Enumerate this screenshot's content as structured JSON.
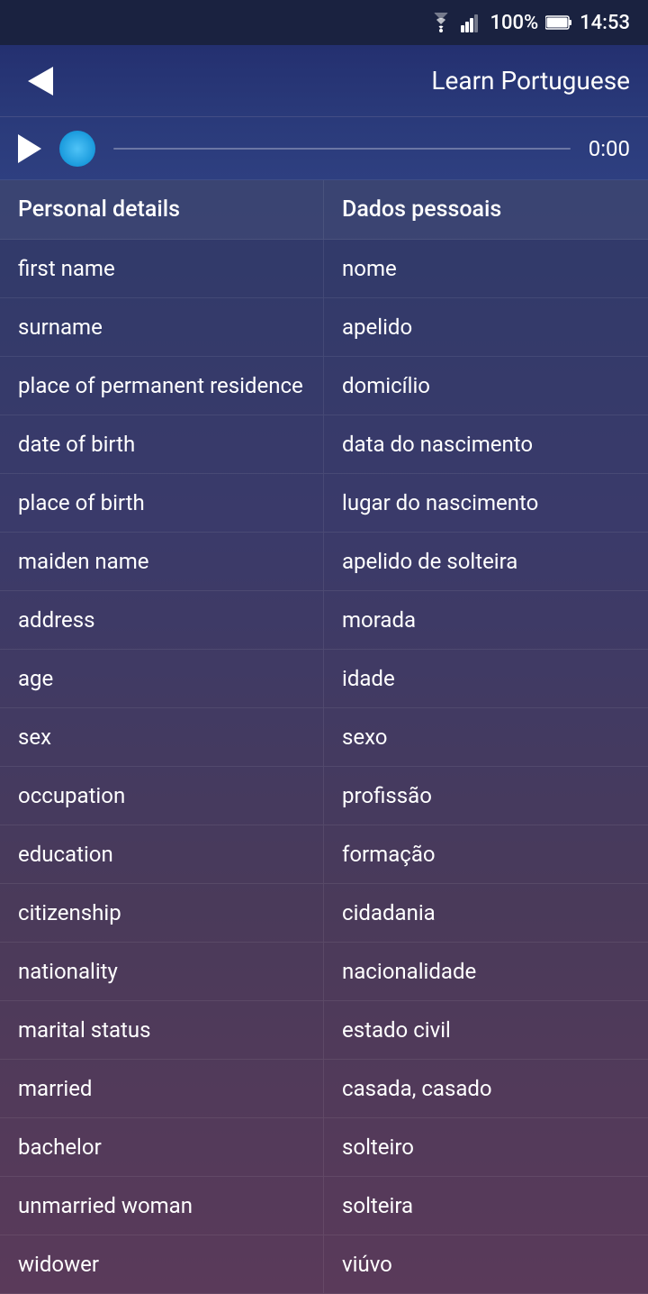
{
  "status_bar": {
    "battery": "100%",
    "time": "14:53"
  },
  "header": {
    "title": "Learn Portuguese",
    "back_label": "back"
  },
  "audio": {
    "play_label": "play",
    "time": "0:00"
  },
  "vocab": [
    {
      "en": "Personal details",
      "pt": "Dados pessoais",
      "is_header": true
    },
    {
      "en": "first name",
      "pt": "nome",
      "is_header": false
    },
    {
      "en": "surname",
      "pt": "apelido",
      "is_header": false
    },
    {
      "en": "place of permanent residence",
      "pt": "domicílio",
      "is_header": false
    },
    {
      "en": "date of birth",
      "pt": "data do nascimento",
      "is_header": false
    },
    {
      "en": "place of birth",
      "pt": "lugar do nascimento",
      "is_header": false
    },
    {
      "en": "maiden name",
      "pt": "apelido de solteira",
      "is_header": false
    },
    {
      "en": "address",
      "pt": "morada",
      "is_header": false
    },
    {
      "en": "age",
      "pt": "idade",
      "is_header": false
    },
    {
      "en": "sex",
      "pt": "sexo",
      "is_header": false
    },
    {
      "en": "occupation",
      "pt": "profissão",
      "is_header": false
    },
    {
      "en": "education",
      "pt": "formação",
      "is_header": false
    },
    {
      "en": "citizenship",
      "pt": "cidadania",
      "is_header": false
    },
    {
      "en": "nationality",
      "pt": "nacionalidade",
      "is_header": false
    },
    {
      "en": "marital status",
      "pt": "estado civil",
      "is_header": false
    },
    {
      "en": "married",
      "pt": "casada, casado",
      "is_header": false
    },
    {
      "en": "bachelor",
      "pt": "solteiro",
      "is_header": false
    },
    {
      "en": "unmarried woman",
      "pt": "solteira",
      "is_header": false
    },
    {
      "en": "widower",
      "pt": "viúvo",
      "is_header": false
    }
  ]
}
